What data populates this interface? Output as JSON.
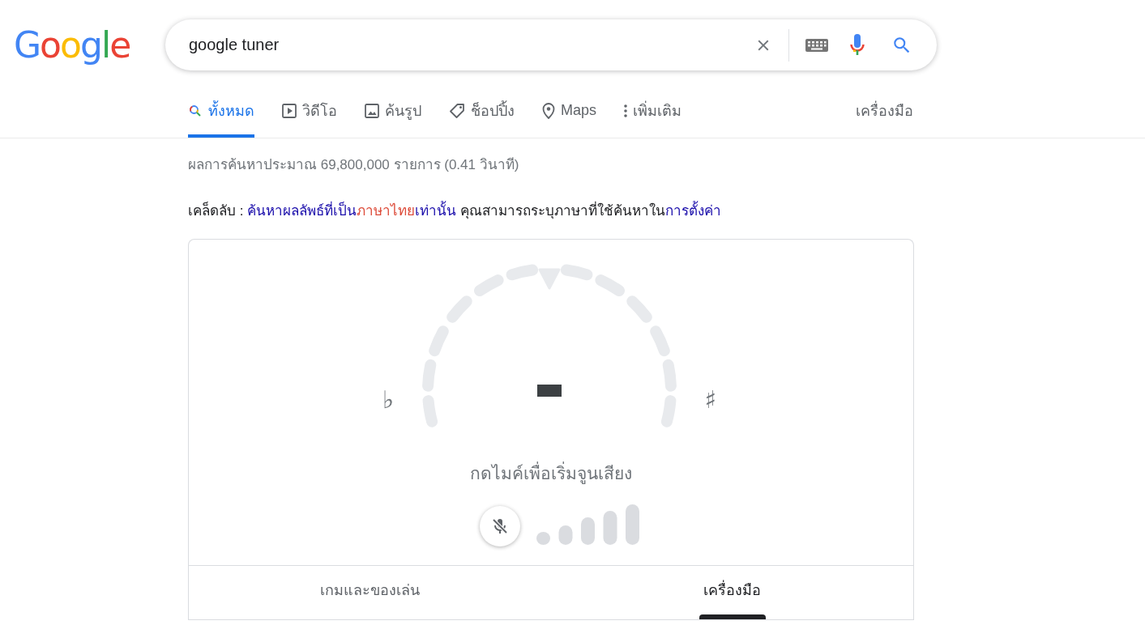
{
  "logo": {
    "text": "Google"
  },
  "search": {
    "value": "google tuner"
  },
  "tabs": [
    {
      "label": "ทั้งหมด",
      "kind": "search",
      "selected": true
    },
    {
      "label": "วิดีโอ",
      "kind": "video",
      "selected": false
    },
    {
      "label": "ค้นรูป",
      "kind": "image",
      "selected": false
    },
    {
      "label": "ช็อปปิ้ง",
      "kind": "shopping",
      "selected": false
    },
    {
      "label": "Maps",
      "kind": "maps",
      "selected": false
    },
    {
      "label": "เพิ่มเติม",
      "kind": "more",
      "selected": false
    }
  ],
  "tools_button": "เครื่องมือ",
  "result_stats": "ผลการค้นหาประมาณ 69,800,000 รายการ (0.41 วินาที)",
  "tip": {
    "label": "เคล็ดลับ : ",
    "link_before": "ค้นหาผลลัพธ์ที่เป็น",
    "link_highlight": "ภาษาไทย",
    "link_after": "เท่านั้น",
    "text": " คุณสามารถระบุภาษาที่ใช้ค้นหาใน",
    "settings_link": "การตั้งค่า"
  },
  "tuner": {
    "flat": "♭",
    "sharp": "♯",
    "prompt": "กดไมค์เพื่อเริ่มจูนเสียง",
    "mic_muted": true
  },
  "card_tabs": [
    {
      "label": "เกมและของเล่น",
      "selected": false
    },
    {
      "label": "เครื่องมือ",
      "selected": true
    }
  ]
}
